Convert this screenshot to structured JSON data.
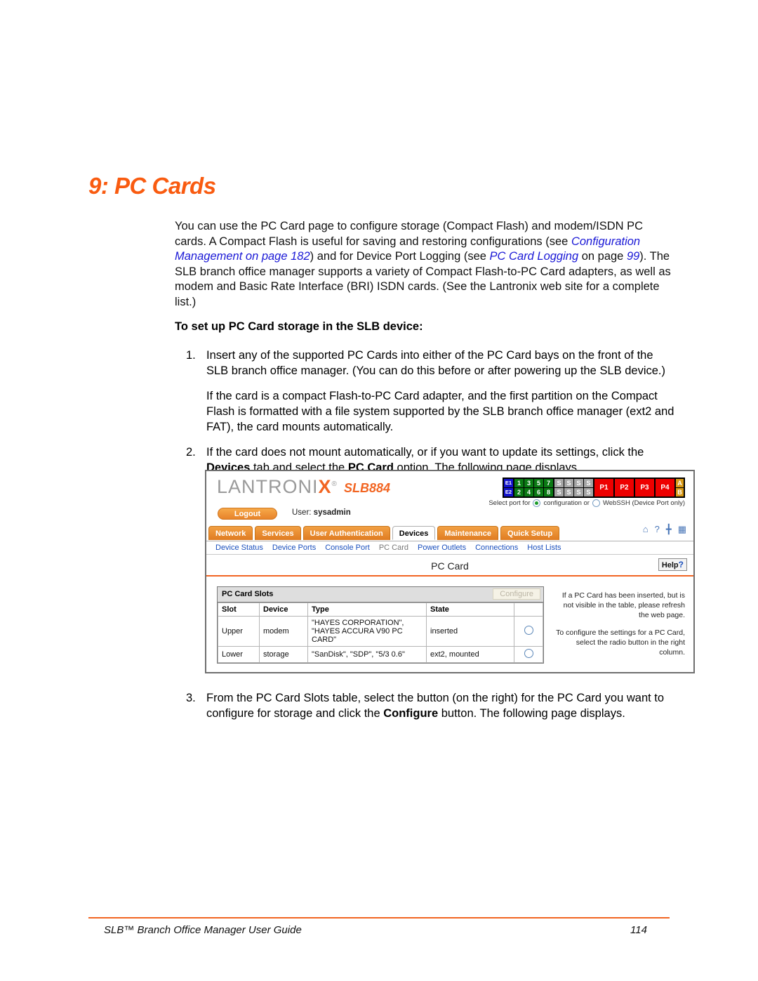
{
  "chapter": {
    "title": "9: PC Cards"
  },
  "intro": {
    "p1_a": "You can use the PC Card page to configure storage (Compact Flash) and modem/ISDN PC cards. A Compact Flash is useful for saving and restoring configurations (see ",
    "xref1": "Configuration Management on page 182",
    "p1_b": ") and for Device Port Logging (see ",
    "xref2": "PC Card Logging",
    "p1_c": " on page ",
    "xref3": "99",
    "p1_d": "). The SLB branch office manager supports a variety of Compact Flash-to-PC Card adapters, as well as modem and Basic Rate Interface (BRI) ISDN cards. (See the Lantronix web site for a complete list.)",
    "lead_in": "To set up PC Card storage in the SLB device:"
  },
  "steps": [
    {
      "num": "1.",
      "text": "Insert any of the supported PC Cards into either of the PC Card bays on the front of the SLB branch office manager. (You can do this before or after powering up the SLB device.)",
      "sub": "If the card is a compact Flash-to-PC Card adapter, and the first partition on the Compact Flash is formatted with a file system supported by the SLB branch office manager (ext2 and FAT), the card mounts automatically."
    },
    {
      "num": "2.",
      "text_a": "If the card does not mount automatically, or if you want to update its settings, click the ",
      "bold1": "Devices",
      "text_b": " tab and select the ",
      "bold2": "PC Card",
      "text_c": " option. The following page displays."
    },
    {
      "num": "3.",
      "text_a": "From the PC Card Slots table, select the button (on the right) for the PC Card you want to configure for storage and click the ",
      "bold1": "Configure",
      "text_b": " button. The following page displays."
    }
  ],
  "app": {
    "logo_gray_1": "LANTRONI",
    "logo_x": "X",
    "logo_reg": "®",
    "model": "SLB884",
    "logout_label": "Logout",
    "user_prefix": "User: ",
    "user_name": "sysadmin",
    "ports": {
      "ethernet": [
        "E1",
        "E2"
      ],
      "device_top": [
        "1",
        "3",
        "5",
        "7"
      ],
      "device_bottom": [
        "2",
        "4",
        "6",
        "8"
      ],
      "serial_top": [
        "S",
        "S",
        "S",
        "S"
      ],
      "serial_bottom": [
        "S",
        "S",
        "S",
        "S"
      ],
      "power": [
        "P1",
        "P2",
        "P3",
        "P4"
      ],
      "aux": [
        "A",
        "B"
      ]
    },
    "select_port": {
      "prefix": "Select port for",
      "option1": "configuration or",
      "option2": "WebSSH (Device Port only)"
    },
    "tabs": [
      {
        "label": "Network",
        "active": false
      },
      {
        "label": "Services",
        "active": false
      },
      {
        "label": "User Authentication",
        "active": false
      },
      {
        "label": "Devices",
        "active": true
      },
      {
        "label": "Maintenance",
        "active": false
      },
      {
        "label": "Quick Setup",
        "active": false
      }
    ],
    "tool_icons": [
      "home-icon",
      "help-question-icon",
      "expand-icon",
      "log-icon"
    ],
    "subnav": [
      {
        "label": "Device Status",
        "current": false
      },
      {
        "label": "Device Ports",
        "current": false
      },
      {
        "label": "Console Port",
        "current": false
      },
      {
        "label": "PC Card",
        "current": true
      },
      {
        "label": "Power Outlets",
        "current": false
      },
      {
        "label": "Connections",
        "current": false
      },
      {
        "label": "Host Lists",
        "current": false
      }
    ],
    "page_title": "PC Card",
    "help_label": "Help",
    "help_mark": "?",
    "slots_panel": {
      "title": "PC Card Slots",
      "configure_label": "Configure",
      "columns": [
        "Slot",
        "Device",
        "Type",
        "State",
        ""
      ],
      "rows": [
        {
          "slot": "Upper",
          "device": "modem",
          "type": "\"HAYES CORPORATION\", \"HAYES ACCURA V90 PC CARD\"",
          "state": "inserted"
        },
        {
          "slot": "Lower",
          "device": "storage",
          "type": "\"SanDisk\", \"SDP\", \"5/3 0.6\"",
          "state": "ext2, mounted"
        }
      ]
    },
    "side_help": {
      "p1": "If a PC Card has been inserted, but is not visible in the table, please refresh the web page.",
      "p2": "To configure the settings for a PC Card, select the radio button in the right column."
    }
  },
  "footer": {
    "left": "SLB™ Branch Office Manager User Guide",
    "page": "114"
  },
  "colors": {
    "accent_orange": "#F26522",
    "heading_orange": "#F95B10",
    "xref_blue": "#1a18d6",
    "link_blue": "#1a4fbd"
  }
}
